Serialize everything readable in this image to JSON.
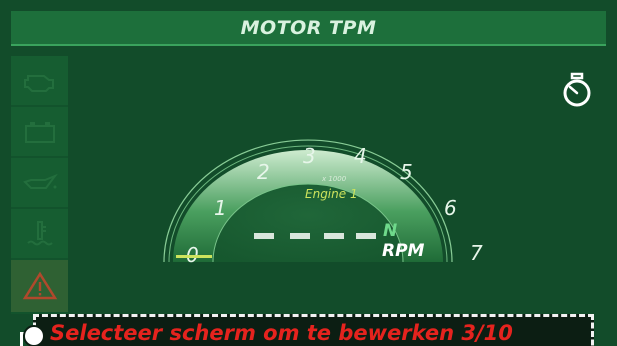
{
  "header": {
    "title": "MOTOR TPM"
  },
  "sidebar": {
    "items": [
      {
        "icon": "engine-icon"
      },
      {
        "icon": "battery-icon"
      },
      {
        "icon": "oil-can-icon"
      },
      {
        "icon": "coolant-temperature-icon"
      },
      {
        "icon": "warning-icon"
      }
    ]
  },
  "corner_icon": "engine-gauge-icon",
  "gauge": {
    "ticks": [
      "0",
      "1",
      "2",
      "3",
      "4",
      "5",
      "6",
      "7"
    ],
    "scale": "x 1000",
    "engine": "Engine 1",
    "gear": "N",
    "unit": "RPM",
    "rpm_display": "- - - -"
  },
  "banner": {
    "text": "Selecteer scherm om te bewerken 3/10"
  },
  "colors": {
    "background": "#124c2a",
    "header": "#1d6f3b",
    "accent_red": "#e5231e",
    "engine_label": "#cde35d"
  }
}
